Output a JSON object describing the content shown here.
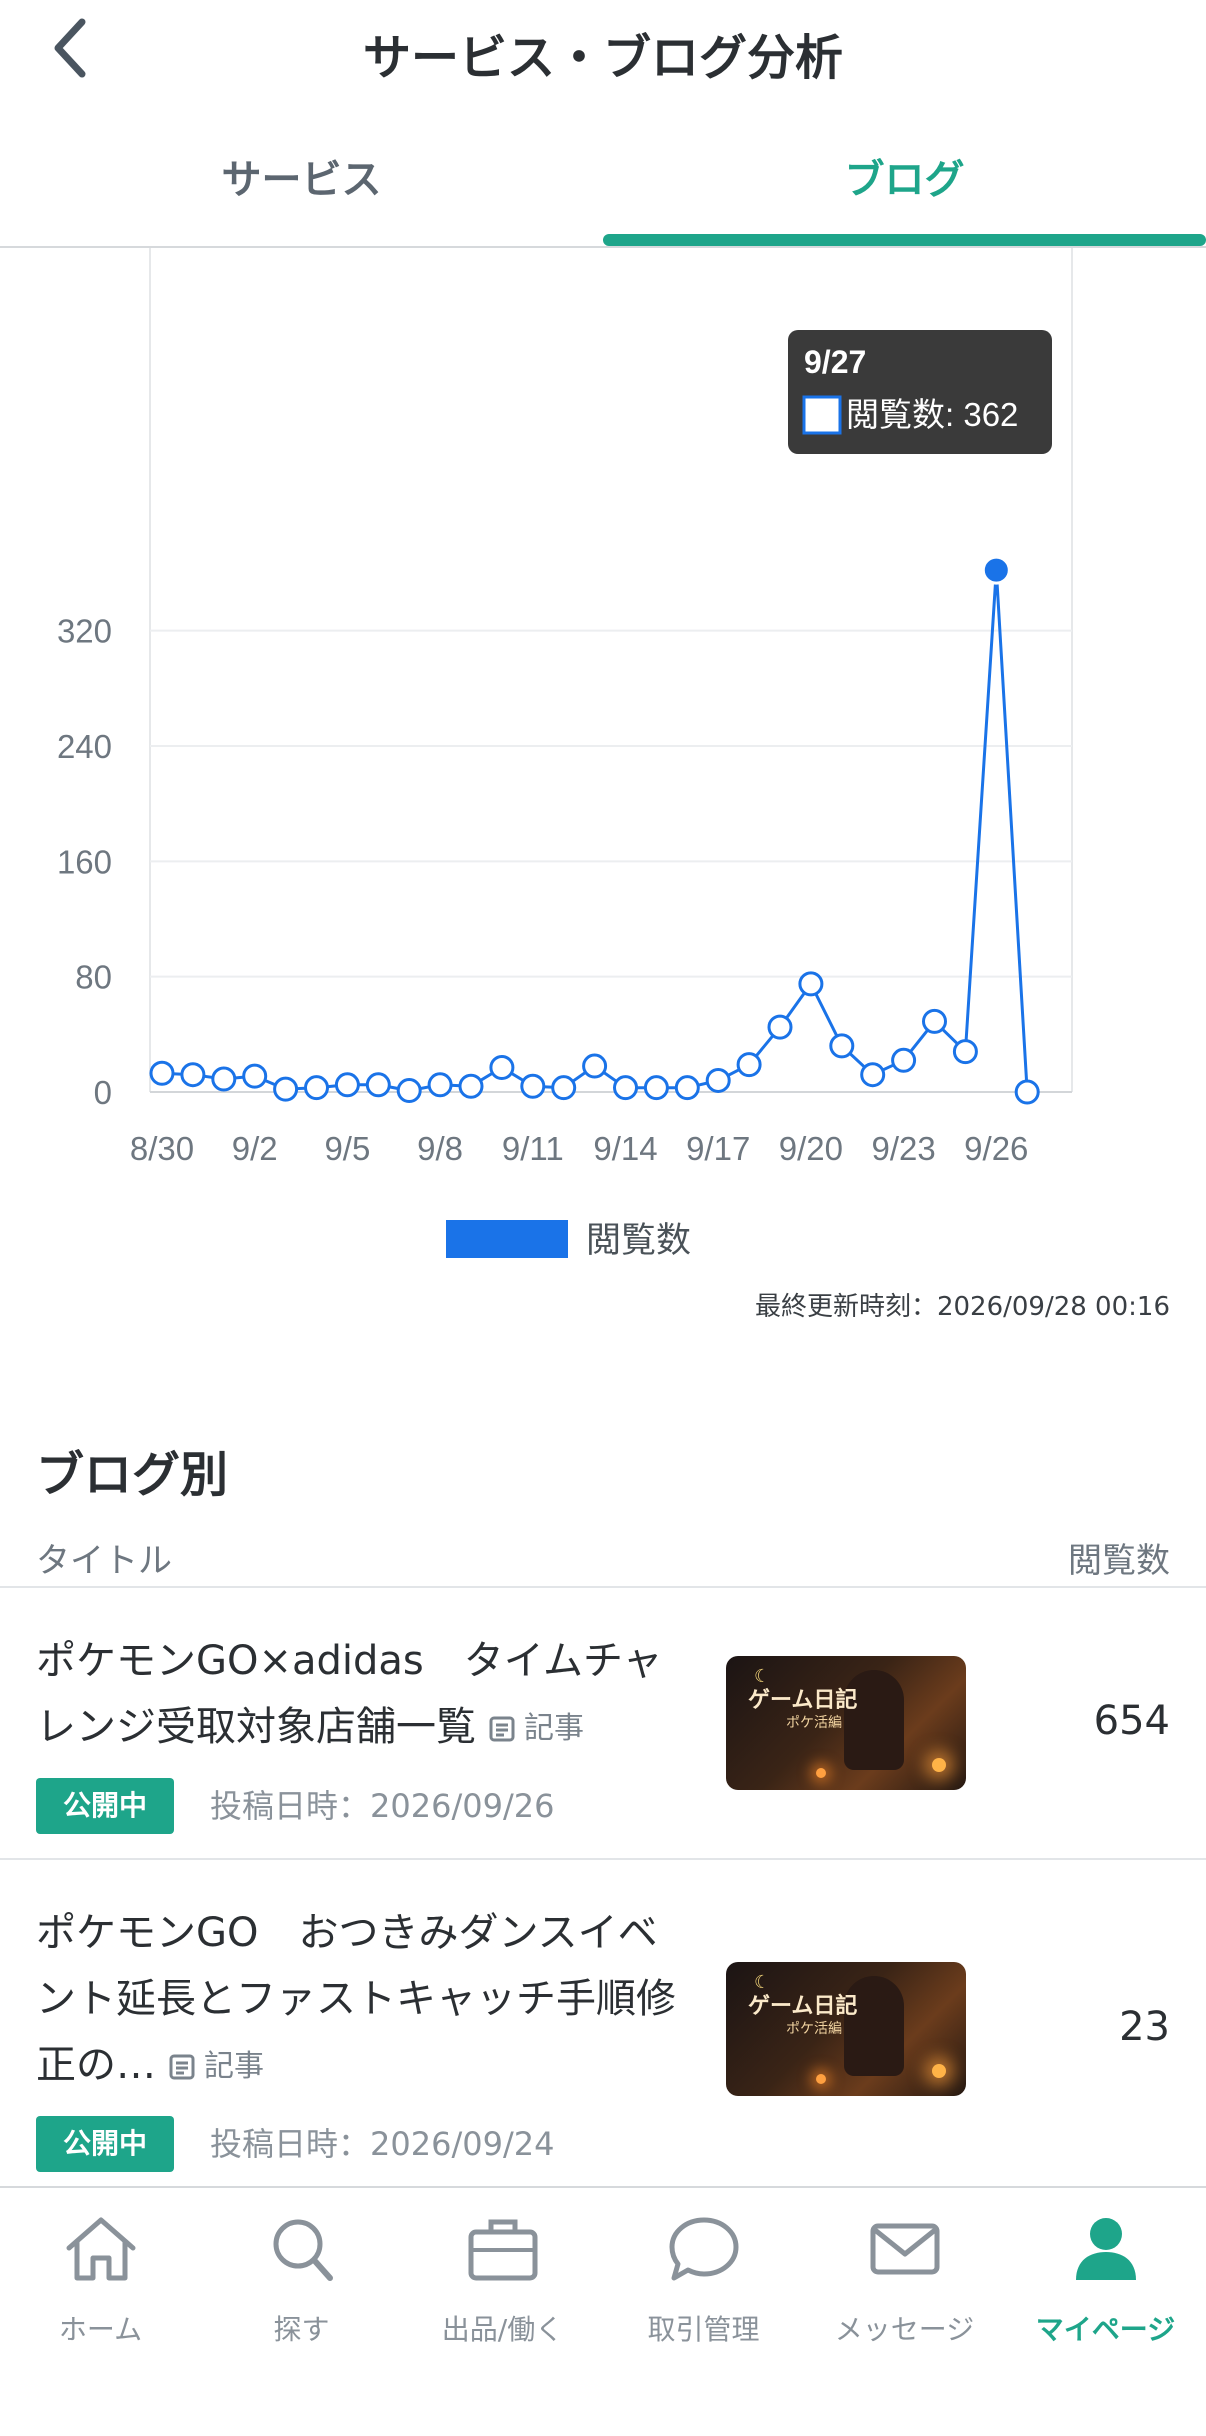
{
  "header": {
    "title": "サービス・ブログ分析"
  },
  "tabs": [
    {
      "label": "サービス"
    },
    {
      "label": "ブログ"
    }
  ],
  "chart_data": {
    "type": "line",
    "categories": [
      "8/30",
      "8/31",
      "9/1",
      "9/2",
      "9/3",
      "9/4",
      "9/5",
      "9/6",
      "9/7",
      "9/8",
      "9/9",
      "9/10",
      "9/11",
      "9/12",
      "9/13",
      "9/14",
      "9/15",
      "9/16",
      "9/17",
      "9/18",
      "9/19",
      "9/20",
      "9/21",
      "9/22",
      "9/23",
      "9/24",
      "9/25",
      "9/26",
      "9/27",
      "9/28"
    ],
    "series": [
      {
        "name": "閲覧数",
        "values": [
          13,
          12,
          9,
          11,
          2,
          3,
          5,
          5,
          1,
          5,
          4,
          17,
          4,
          3,
          18,
          3,
          3,
          3,
          8,
          19,
          45,
          75,
          32,
          12,
          22,
          49,
          28,
          362,
          0
        ],
        "color": "#1a73e8"
      }
    ],
    "xticks": [
      "8/30",
      "9/2",
      "9/5",
      "9/8",
      "9/11",
      "9/14",
      "9/17",
      "9/20",
      "9/23",
      "9/26"
    ],
    "yticks": [
      0,
      80,
      160,
      240,
      320
    ],
    "ylim": [
      0,
      390
    ],
    "grid": true,
    "legend": "bottom-center",
    "tooltip": {
      "date": "9/27",
      "label": "閲覧数: 362"
    }
  },
  "updated": "最終更新時刻：2026/09/28 00:16",
  "blog_section": {
    "title": "ブログ別",
    "col_title": "タイトル",
    "col_views": "閲覧数",
    "rows": [
      {
        "title": "ポケモンGO×adidas　タイムチャレンジ受取対象店舗一覧",
        "type": "記事",
        "status": "公開中",
        "date": "投稿日時：2026/09/26",
        "views": "654",
        "thumb_title": "ゲーム日記",
        "thumb_sub": "ポケ活編"
      },
      {
        "title": "ポケモンGO　おつきみダンスイベント延長とファストキャッチ手順修正の…",
        "type": "記事",
        "status": "公開中",
        "date": "投稿日時：2026/09/24",
        "views": "23",
        "thumb_title": "ゲーム日記",
        "thumb_sub": "ポケ活編"
      }
    ]
  },
  "nav": [
    {
      "label": "ホーム",
      "icon": "home-icon"
    },
    {
      "label": "探す",
      "icon": "search-icon"
    },
    {
      "label": "出品/働く",
      "icon": "briefcase-icon"
    },
    {
      "label": "取引管理",
      "icon": "chat-bubble-icon"
    },
    {
      "label": "メッセージ",
      "icon": "mail-icon"
    },
    {
      "label": "マイページ",
      "icon": "person-icon"
    }
  ],
  "colors": {
    "accent": "#1ea58a",
    "series": "#1a73e8"
  }
}
